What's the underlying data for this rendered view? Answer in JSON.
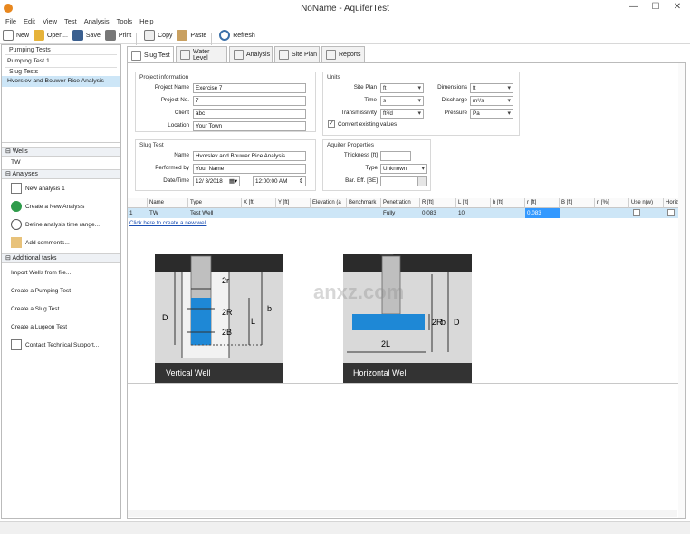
{
  "window": {
    "title": "NoName - AquiferTest",
    "minimize": "—",
    "maximize": "☐",
    "close": "✕"
  },
  "menu": [
    "File",
    "Edit",
    "View",
    "Test",
    "Analysis",
    "Tools",
    "Help"
  ],
  "toolbar": {
    "new": "New",
    "open": "Open...",
    "save": "Save",
    "print": "Print",
    "copy": "Copy",
    "paste": "Paste",
    "refresh": "Refresh"
  },
  "tree": {
    "pumping_header": "Pumping Tests",
    "pumping_item": "Pumping Test 1",
    "slug_header": "Slug Tests",
    "slug_item": "Hvorslev and Bouwer Rice Analysis"
  },
  "wells": {
    "header": "Wells",
    "item": "TW"
  },
  "analyses": {
    "header": "Analyses",
    "items": [
      "New analysis 1",
      "Create a New Analysis",
      "Define analysis time range...",
      "Add comments..."
    ]
  },
  "additional": {
    "header": "Additional tasks",
    "items": [
      "Import Wells from file...",
      "Create a Pumping Test",
      "Create a Slug Test",
      "Create a Lugeon Test",
      "Contact Technical Support..."
    ]
  },
  "tabs": [
    "Slug Test",
    "Water Level",
    "Analysis",
    "Site Plan",
    "Reports"
  ],
  "project": {
    "group": "Project information",
    "name_label": "Project Name",
    "name": "Exercise 7",
    "no_label": "Project No.",
    "no": "7",
    "client_label": "Client",
    "client": "abc",
    "location_label": "Location",
    "location": "Your Town"
  },
  "units": {
    "group": "Units",
    "site_plan_label": "Site Plan",
    "site_plan": "ft",
    "time_label": "Time",
    "time": "s",
    "trans_label": "Transmissivity",
    "trans": "ft²/d",
    "dim_label": "Dimensions",
    "dim": "ft",
    "discharge_label": "Discharge",
    "discharge": "m³/s",
    "pressure_label": "Pressure",
    "pressure": "Pa",
    "convert_label": "Convert existing values"
  },
  "slug": {
    "group": "Slug Test",
    "name_label": "Name",
    "name": "Hvorslev and Bouwer Rice Analysis",
    "by_label": "Performed by",
    "by": "Your Name",
    "dt_label": "Date/Time",
    "date": "12/ 3/2018",
    "time": "12:00:00 AM"
  },
  "aquifer": {
    "group": "Aquifer Properties",
    "thickness_label": "Thickness [ft]",
    "thickness": "",
    "type_label": "Type",
    "type": "Unknown",
    "baro_label": "Bar. Eff. [BE]"
  },
  "grid": {
    "headers": [
      "",
      "Name",
      "Type",
      "X [ft]",
      "Y [ft]",
      "Elevation (a",
      "Benchmark",
      "Penetration",
      "R [ft]",
      "L [ft]",
      "b [ft]",
      "r [ft]",
      "B [ft]",
      "n [%]",
      "Use n(w)",
      "Horizon"
    ],
    "row": [
      "1",
      "TW",
      "Test Well",
      "",
      "",
      "",
      "",
      "Fully",
      "0.083",
      "10",
      "",
      "0.083",
      "",
      "",
      "",
      ""
    ],
    "new_link": "Click here to create a new well"
  },
  "diagram": {
    "vertical_caption": "Vertical Well",
    "horizontal_caption": "Horizontal Well",
    "lbl_2r": "2r",
    "lbl_2R": "2R",
    "lbl_2B": "2B",
    "lbl_D": "D",
    "lbl_L": "L",
    "lbl_b": "b",
    "lbl_2L": "2L",
    "lbl_2Rh": "2R",
    "lbl_bh": "b",
    "lbl_Dh": "D"
  },
  "watermark": "anxz.com",
  "colors": {
    "selection": "#cde6f7",
    "cell_highlight": "#3399ff",
    "water": "#1e88d6",
    "ground": "#2b2b2b",
    "caption_bg": "#333333"
  }
}
